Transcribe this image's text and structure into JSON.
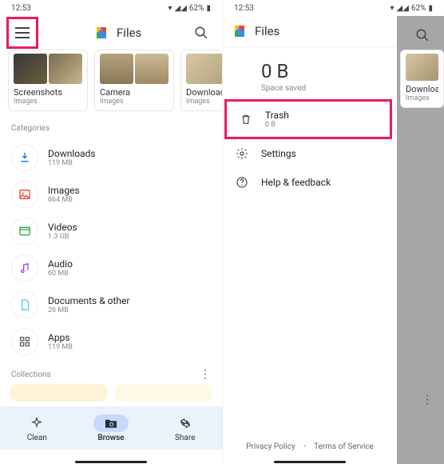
{
  "status": {
    "time": "12:53",
    "battery": "62%"
  },
  "app": {
    "title": "Files"
  },
  "recent": [
    {
      "title": "Screenshots",
      "sub": "Images"
    },
    {
      "title": "Camera",
      "sub": "Images"
    },
    {
      "title": "Downloads",
      "sub": "Images"
    }
  ],
  "sections": {
    "categories": "Categories",
    "collections": "Collections"
  },
  "categories": [
    {
      "name": "Downloads",
      "sub": "119 MB",
      "color": "#1a73e8"
    },
    {
      "name": "Images",
      "sub": "664 MB",
      "color": "#ea4335"
    },
    {
      "name": "Videos",
      "sub": "1.3 GB",
      "color": "#34a853"
    },
    {
      "name": "Audio",
      "sub": "60 MB",
      "color": "#a142f4"
    },
    {
      "name": "Documents & other",
      "sub": "26 MB",
      "color": "#1a73e8"
    },
    {
      "name": "Apps",
      "sub": "119 MB",
      "color": "#5f6368"
    }
  ],
  "nav": {
    "clean": "Clean",
    "browse": "Browse",
    "share": "Share"
  },
  "drawer": {
    "storage_value": "0 B",
    "storage_label": "Space saved",
    "trash": "Trash",
    "trash_sub": "0 B",
    "settings": "Settings",
    "help": "Help & feedback"
  },
  "footer": {
    "privacy": "Privacy Policy",
    "terms": "Terms of Service"
  }
}
